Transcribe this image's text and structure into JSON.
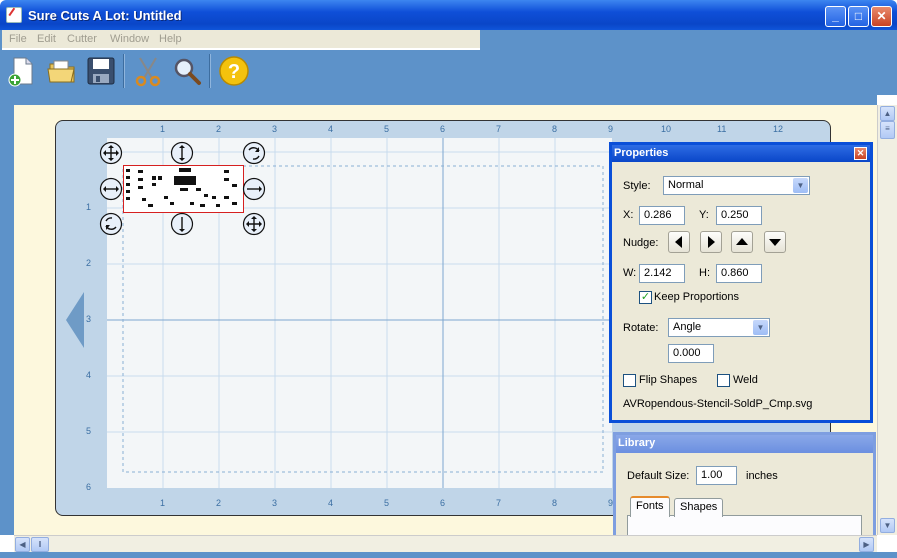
{
  "window": {
    "title": "Sure Cuts A Lot: Untitled",
    "minimize": "_",
    "maximize": "□",
    "close": "✕"
  },
  "menu": {
    "items": [
      "File",
      "Edit",
      "Cutter",
      "Window",
      "Help"
    ]
  },
  "toolbar": {
    "icons": [
      "new-document-icon",
      "open-folder-icon",
      "save-disk-icon",
      "scissors-cut-icon",
      "magnifier-icon",
      "help-icon"
    ]
  },
  "ruler": {
    "top": [
      "1",
      "2",
      "3",
      "4",
      "5",
      "6",
      "7",
      "8",
      "9",
      "10",
      "11",
      "12"
    ],
    "left": [
      "1",
      "2",
      "3",
      "4",
      "5",
      "6"
    ]
  },
  "properties": {
    "title": "Properties",
    "close": "✕",
    "style_label": "Style:",
    "style_value": "Normal",
    "x_label": "X:",
    "x_value": "0.286",
    "y_label": "Y:",
    "y_value": "0.250",
    "nudge_label": "Nudge:",
    "w_label": "W:",
    "w_value": "2.142",
    "h_label": "H:",
    "h_value": "0.860",
    "keep_proportions_label": "Keep Proportions",
    "keep_proportions_checked": true,
    "rotate_label": "Rotate:",
    "rotate_mode": "Angle",
    "rotate_value": "0.000",
    "flip_label": "Flip Shapes",
    "weld_label": "Weld",
    "filename": "AVRopendous-Stencil-SoldP_Cmp.svg"
  },
  "library": {
    "title": "Library",
    "default_size_label": "Default Size:",
    "default_size_value": "1.00",
    "unit": "inches",
    "tabs": [
      "Fonts",
      "Shapes"
    ]
  },
  "colors": {
    "desktop_blue": "#5d92c9",
    "cream": "#fdf8dd",
    "selection_red": "#d62020",
    "title_blue": "#0a46c8"
  }
}
